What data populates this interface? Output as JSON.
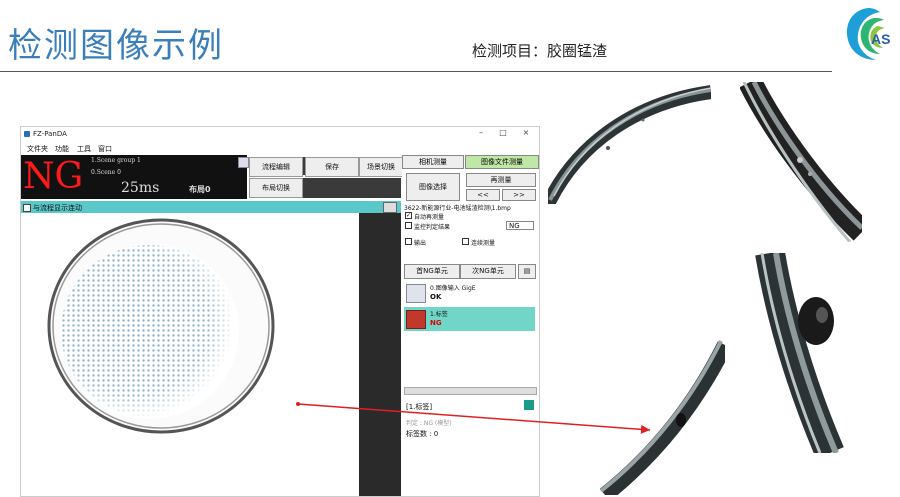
{
  "slide": {
    "title": "检测图像示例",
    "subtitle": "检测项目：胶圈锰渣",
    "logo_text": "AS"
  },
  "app": {
    "window_title": "FZ-PanDA",
    "window_controls": {
      "minimize": "–",
      "maximize": "□",
      "close": "×"
    },
    "menu": [
      "文件夹",
      "功能",
      "工具",
      "窗口"
    ],
    "status": {
      "result": "NG",
      "scene_group": "1.Scene group 1",
      "scene": "0.Scene 0",
      "time": "25ms",
      "layout": "布局0"
    },
    "toolbar": {
      "flow_edit": "流程编辑",
      "save": "保存",
      "scene_switch": "场景切换",
      "layout_switch": "布局切换"
    },
    "view_header": "与流程显示连动",
    "right_panel": {
      "tab_camera": "相机测量",
      "tab_image_file": "图像文件测量",
      "image_select": "图像选择",
      "remeasure": "再测量",
      "prev": "<<",
      "next": ">>",
      "file_path": "3622-新能源行业-电池锰渣检测\\1.bmp",
      "auto_remeasure": "自动再测量",
      "monitor_judge": "监控判定结果",
      "judge_value": "NG",
      "output": "输出",
      "continuous": "连续测量",
      "first_ng_unit": "首NG单元",
      "next_ng_unit": "次NG单元",
      "units": [
        {
          "name": "0.图像输入 GigE",
          "result": "OK"
        },
        {
          "name": "1.标签",
          "result": "NG"
        }
      ],
      "detail_title": "[1.标签]",
      "detail_judge": "判定 : NG (模型)",
      "detail_count": "标签数 : 0"
    }
  },
  "colors": {
    "title_blue": "#3a7fb9",
    "ng_red": "#ff1a1a",
    "teal": "#5ac8c8",
    "arrow_red": "#e02020"
  }
}
